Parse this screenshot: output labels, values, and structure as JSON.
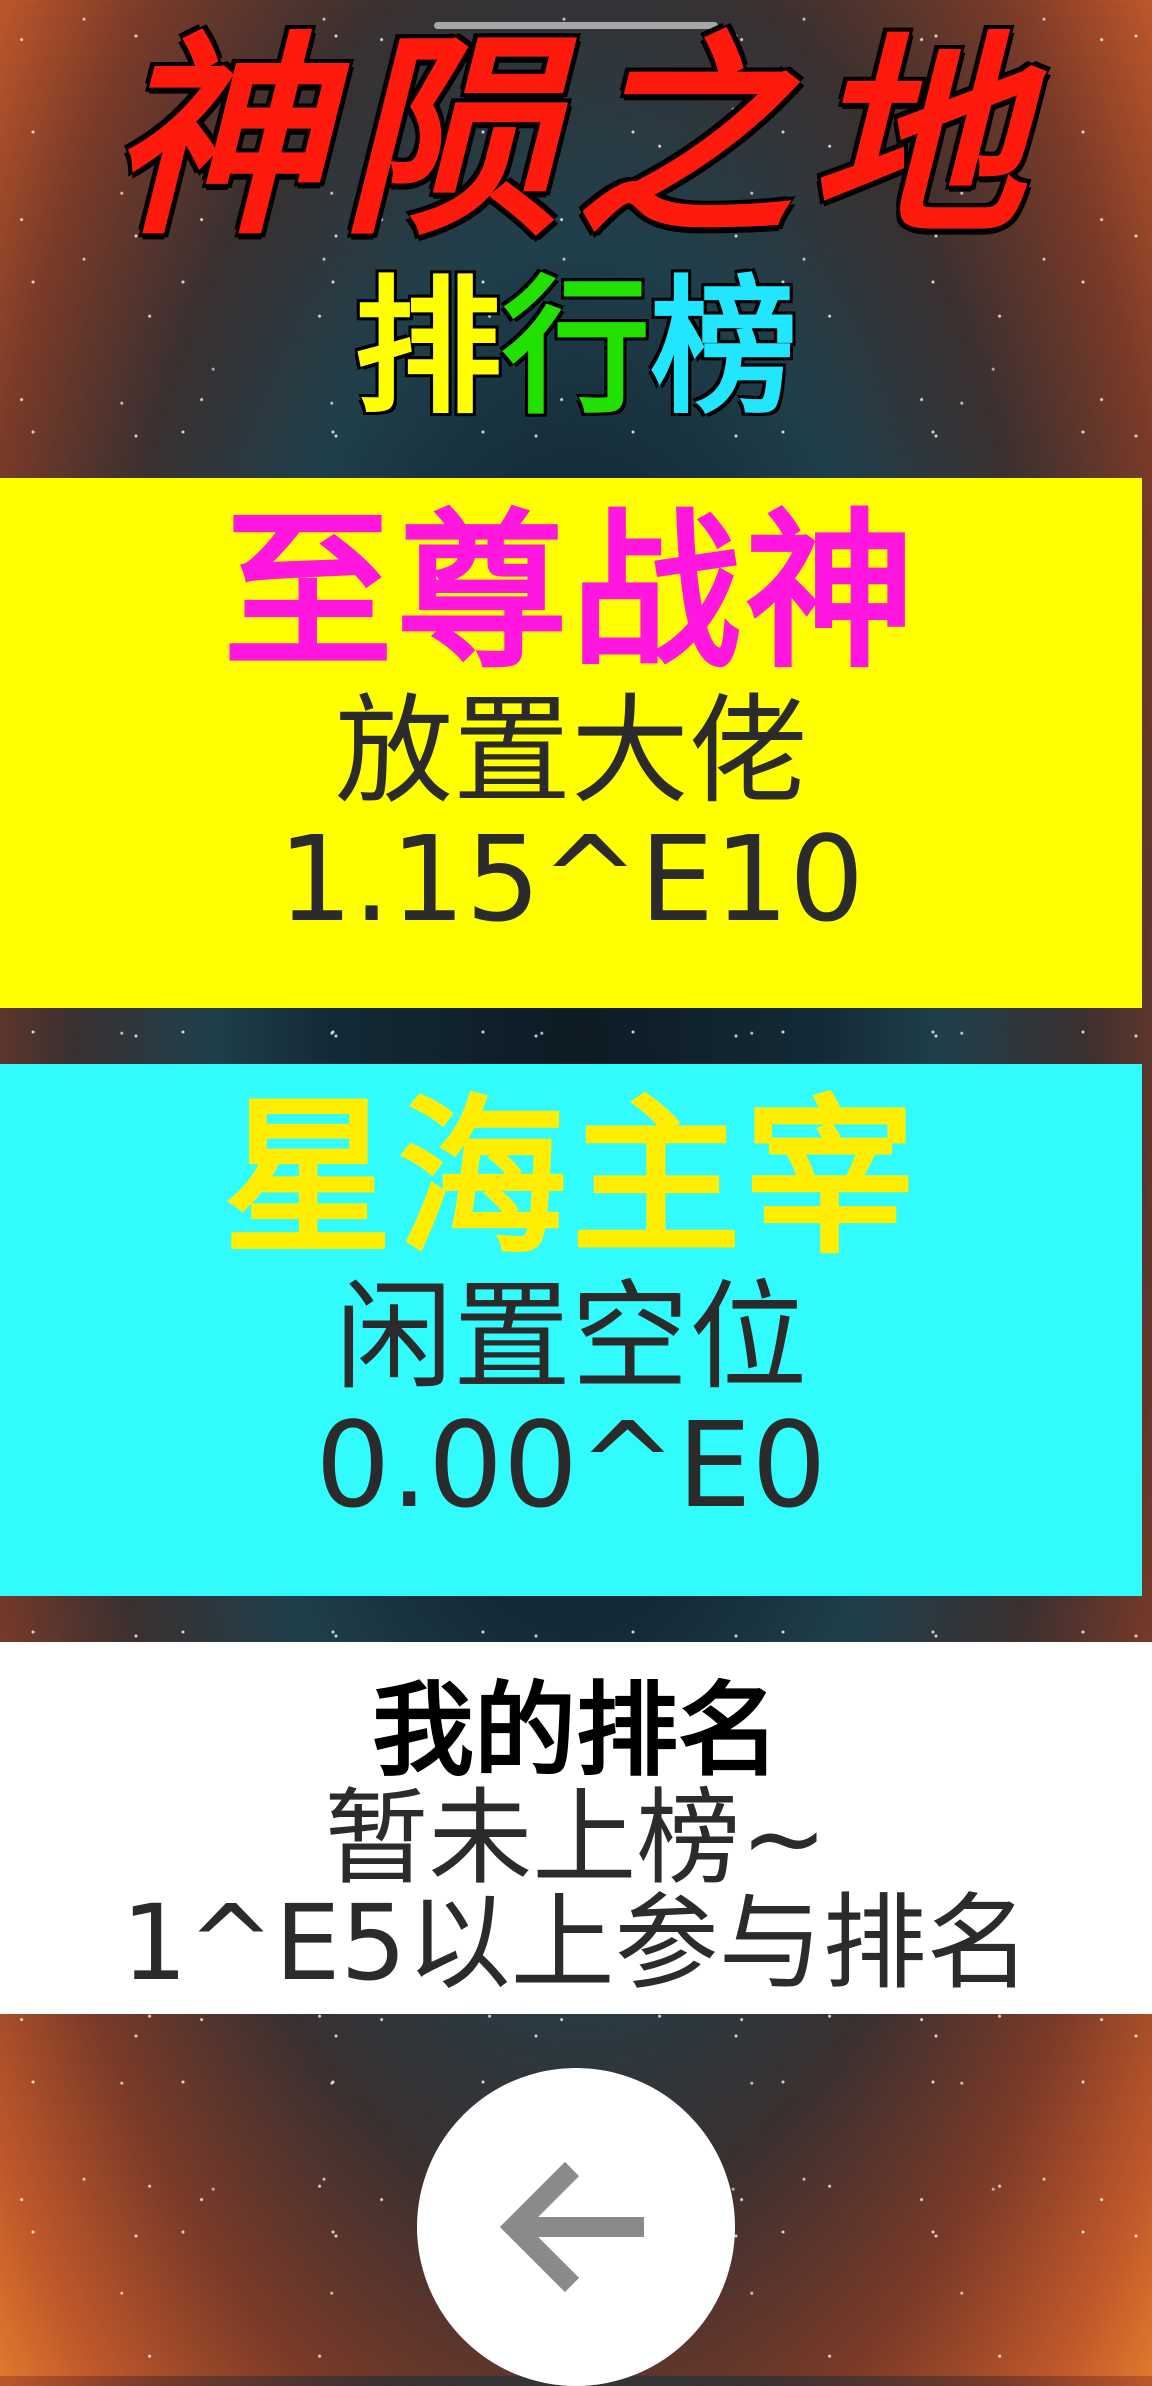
{
  "title": "神陨之地",
  "subtitle": [
    "排",
    "行",
    "榜"
  ],
  "subtitle_colors": [
    "#ffff00",
    "#22e000",
    "#22e6ff"
  ],
  "leaderboard": [
    {
      "rank_title": "至尊战神",
      "player_name": "放置大佬",
      "score": "1.15^E10",
      "bg_color": "#ffff00",
      "title_color": "#ff17e0"
    },
    {
      "rank_title": "星海主宰",
      "player_name": "闲置空位",
      "score": "0.00^E0",
      "bg_color": "#31fbfd",
      "title_color": "#ffee00"
    }
  ],
  "my_rank": {
    "title": "我的排名",
    "status": "暂未上榜~",
    "note": "1^E5以上参与排名"
  },
  "back_button": {
    "icon": "arrow-left-icon"
  }
}
